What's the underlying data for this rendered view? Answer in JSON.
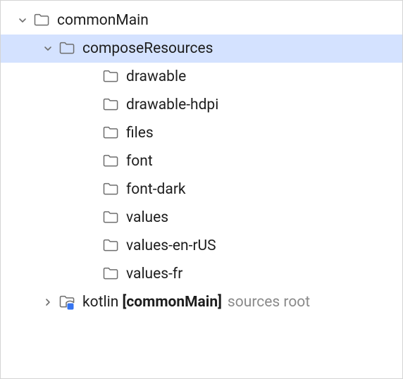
{
  "tree": {
    "nodes": [
      {
        "name": "commonMain",
        "indent": 20,
        "expanded": true,
        "selected": false,
        "hasChildren": true,
        "folderType": "plain",
        "suffix": ""
      },
      {
        "name": "composeResources",
        "indent": 56,
        "expanded": true,
        "selected": true,
        "hasChildren": true,
        "folderType": "plain",
        "suffix": ""
      },
      {
        "name": "drawable",
        "indent": 118,
        "expanded": false,
        "selected": false,
        "hasChildren": false,
        "folderType": "plain",
        "suffix": ""
      },
      {
        "name": "drawable-hdpi",
        "indent": 118,
        "expanded": false,
        "selected": false,
        "hasChildren": false,
        "folderType": "plain",
        "suffix": ""
      },
      {
        "name": "files",
        "indent": 118,
        "expanded": false,
        "selected": false,
        "hasChildren": false,
        "folderType": "plain",
        "suffix": ""
      },
      {
        "name": "font",
        "indent": 118,
        "expanded": false,
        "selected": false,
        "hasChildren": false,
        "folderType": "plain",
        "suffix": ""
      },
      {
        "name": "font-dark",
        "indent": 118,
        "expanded": false,
        "selected": false,
        "hasChildren": false,
        "folderType": "plain",
        "suffix": ""
      },
      {
        "name": "values",
        "indent": 118,
        "expanded": false,
        "selected": false,
        "hasChildren": false,
        "folderType": "plain",
        "suffix": ""
      },
      {
        "name": "values-en-rUS",
        "indent": 118,
        "expanded": false,
        "selected": false,
        "hasChildren": false,
        "folderType": "plain",
        "suffix": ""
      },
      {
        "name": "values-fr",
        "indent": 118,
        "expanded": false,
        "selected": false,
        "hasChildren": false,
        "folderType": "plain",
        "suffix": ""
      },
      {
        "name": "kotlin",
        "boldSuffix": "[commonMain]",
        "indent": 56,
        "expanded": false,
        "selected": false,
        "hasChildren": true,
        "folderType": "source",
        "suffix": "sources root"
      }
    ]
  }
}
